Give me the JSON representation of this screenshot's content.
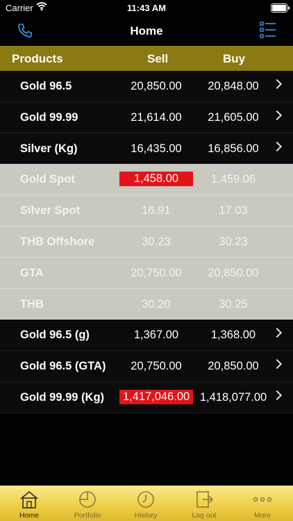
{
  "status": {
    "carrier": "Carrier",
    "time": "11:43 AM"
  },
  "nav": {
    "title": "Home"
  },
  "table": {
    "headers": {
      "products": "Products",
      "sell": "Sell",
      "buy": "Buy"
    },
    "rows": [
      {
        "name": "Gold 96.5",
        "sell": "20,850.00",
        "buy": "20,848.00"
      },
      {
        "name": "Gold 99.99",
        "sell": "21,614.00",
        "buy": "21,605.00"
      },
      {
        "name": "Silver (Kg)",
        "sell": "16,435.00",
        "buy": "16,856.00"
      },
      {
        "name": "Gold Spot",
        "sell": "1,458.00",
        "buy": "1,459.06"
      },
      {
        "name": "Silver Spot",
        "sell": "16.91",
        "buy": "17.03"
      },
      {
        "name": "THB Offshore",
        "sell": "30.23",
        "buy": "30.23"
      },
      {
        "name": "GTA",
        "sell": "20,750.00",
        "buy": "20,850.00"
      },
      {
        "name": "THB",
        "sell": "30.20",
        "buy": "30.25"
      },
      {
        "name": "Gold 96.5 (g)",
        "sell": "1,367.00",
        "buy": "1,368.00"
      },
      {
        "name": "Gold 96.5 (GTA)",
        "sell": "20,750.00",
        "buy": "20,850.00"
      },
      {
        "name": "Gold 99.99 (Kg)",
        "sell": "1,417,046.00",
        "buy": "1,418,077.00"
      }
    ]
  },
  "tabs": [
    {
      "label": "Home",
      "icon": "home-icon"
    },
    {
      "label": "Portfolio",
      "icon": "pie-icon"
    },
    {
      "label": "History",
      "icon": "clock-icon"
    },
    {
      "label": "Log out",
      "icon": "logout-icon"
    },
    {
      "label": "More",
      "icon": "more-icon"
    }
  ],
  "colors": {
    "header": "#8b7a12",
    "highlight": "#e3131a",
    "accent": "#3d9be9"
  }
}
